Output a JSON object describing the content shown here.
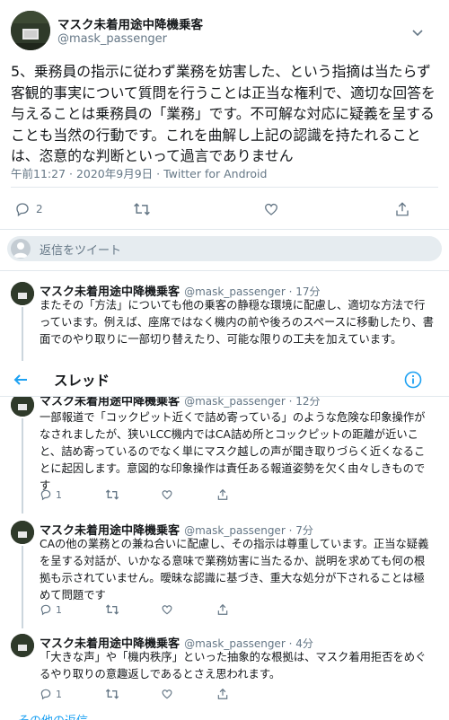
{
  "main_tweet": {
    "name": "マスク未着用途中降機乗客",
    "handle": "@mask_passenger",
    "text": "5、乗務員の指示に従わず業務を妨害した、という指摘は当たらず客観的事実について質問を行うことは正当な権利で、適切な回答を与えることは乗務員の「業務」です。不可解な対応に疑義を呈することも当然の行動です。これを曲解し上記の認識を持たれることは、恣意的な判断といって過言でありません",
    "meta": "午前11:27 · 2020年9月9日 · Twitter for Android",
    "reply_count": "2"
  },
  "reply_box": {
    "placeholder": "返信をツイート"
  },
  "thread_header": {
    "title": "スレッド"
  },
  "replies": [
    {
      "name": "マスク未着用途中降機乗客",
      "handle_time": "@mask_passenger · 17分",
      "text": "またその「方法」についても他の乗客の静穏な環境に配慮し、適切な方法で行っています。例えば、座席ではなく機内の前や後ろのスペースに移動したり、書面でのやり取りに一部切り替えたり、可能な限りの工夫を加えています。"
    },
    {
      "name": "マスク未着用途中降機乗客",
      "handle_time": "@mask_passenger · 12分",
      "text": "一部報道で「コックピット近くで詰め寄っている」のような危険な印象操作がなされましたが、狭いLCC機内ではCA詰め所とコックピットの距離が近いこと、詰め寄っているのでなく単にマスク越しの声が聞き取りづらく近くなることに起因します。意図的な印象操作は責任ある報道姿勢を欠く由々しきものです",
      "reply_count": "1"
    },
    {
      "name": "マスク未着用途中降機乗客",
      "handle_time": "@mask_passenger · 7分",
      "text": "CAの他の業務との兼ね合いに配慮し、その指示は尊重しています。正当な疑義を呈する対話が、いかなる意味で業務妨害に当たるか、説明を求めても何の根拠も示されていません。曖昧な認識に基づき、重大な処分が下されることは極めて問題です",
      "reply_count": "1"
    },
    {
      "name": "マスク未着用途中降機乗客",
      "handle_time": "@mask_passenger · 4分",
      "text": "「大きな声」や「機内秩序」といった抽象的な根拠は、マスク着用拒否をめぐるやり取りの意趣返しであるとさえ思われます。",
      "reply_count": "1"
    }
  ],
  "more_replies": {
    "label": "その他の返信"
  },
  "colors": {
    "accent": "#1da1f2",
    "text": "#14171a",
    "secondary": "#657786",
    "border": "#e1e8ed"
  }
}
